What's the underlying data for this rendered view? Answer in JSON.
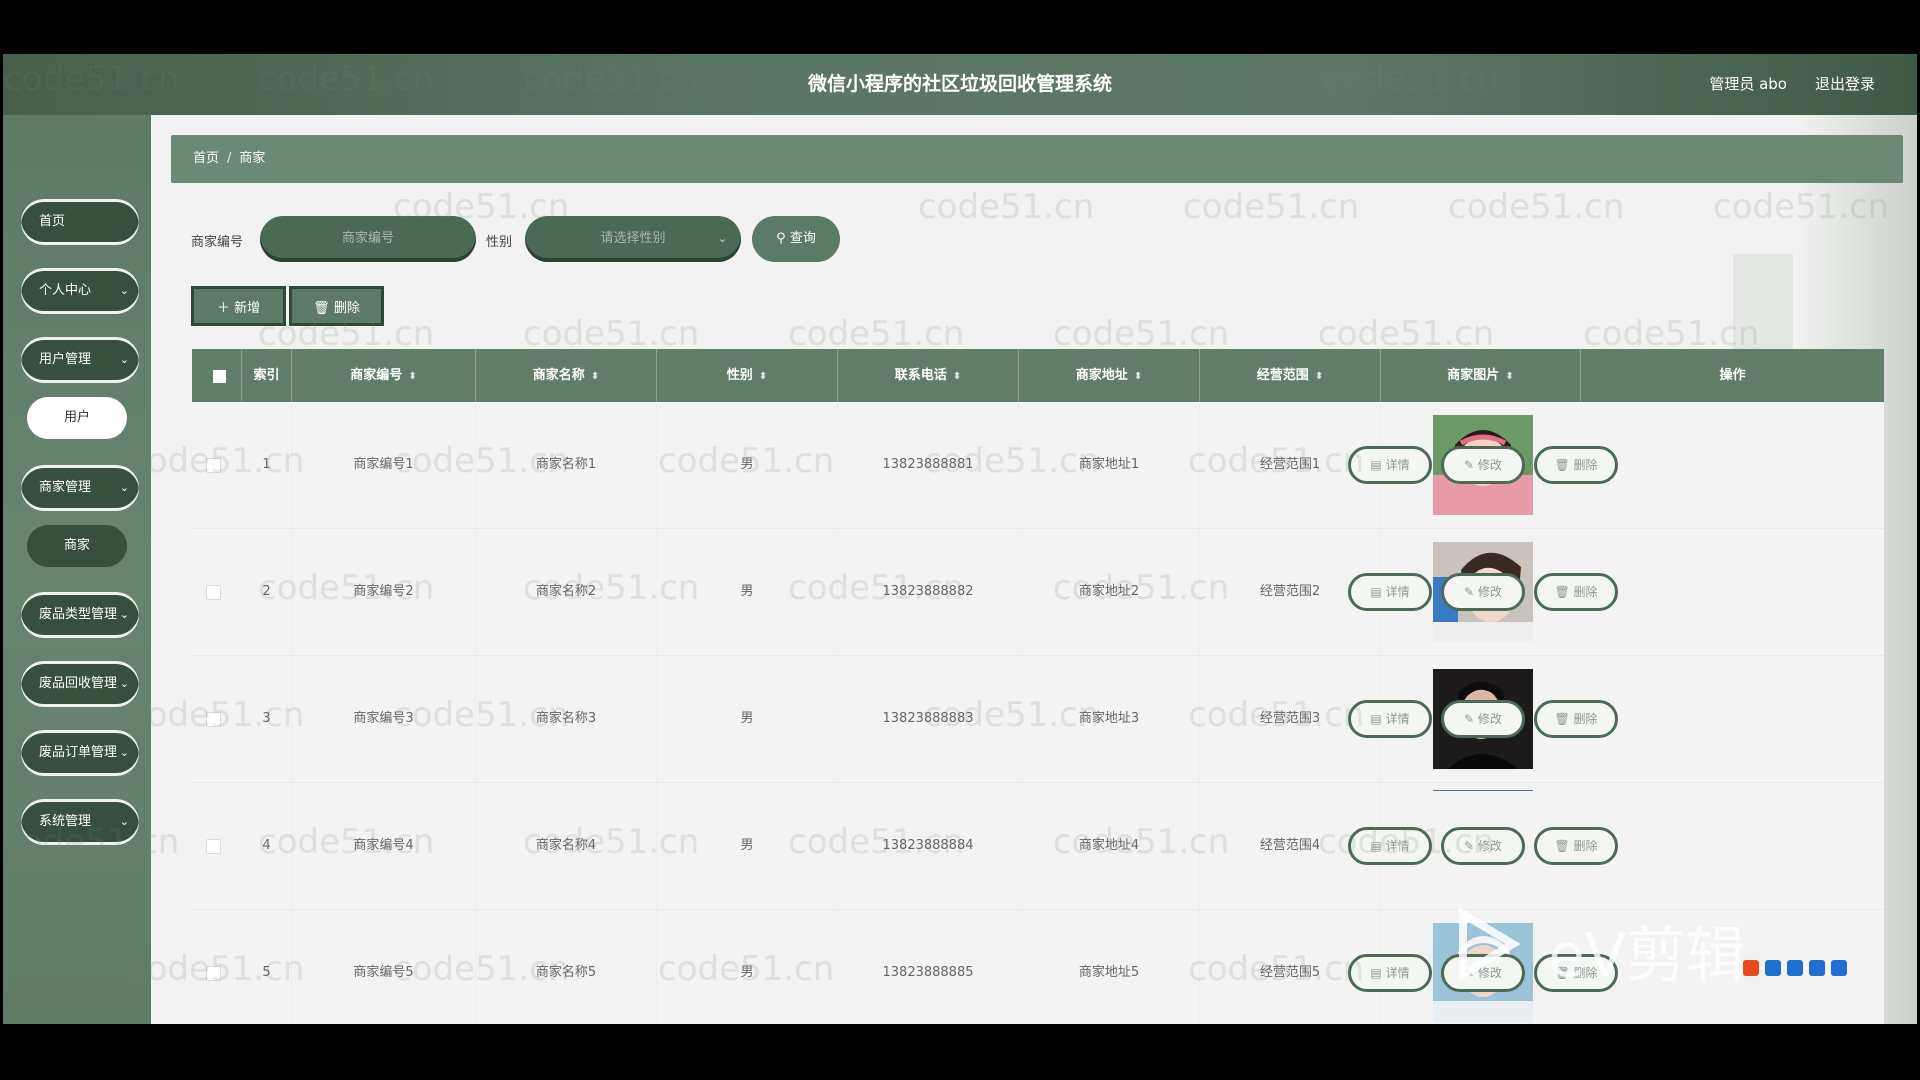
{
  "header": {
    "title": "微信小程序的社区垃圾回收管理系统",
    "user": "管理员 abo",
    "logout": "退出登录"
  },
  "sidebar": {
    "items": [
      {
        "label": "首页",
        "expandable": false
      },
      {
        "label": "个人中心",
        "expandable": true
      },
      {
        "label": "用户管理",
        "expandable": true,
        "children": [
          "用户"
        ]
      },
      {
        "label": "商家管理",
        "expandable": true,
        "children": [
          "商家"
        ]
      },
      {
        "label": "废品类型管理",
        "expandable": true
      },
      {
        "label": "废品回收管理",
        "expandable": true
      },
      {
        "label": "废品订单管理",
        "expandable": true
      },
      {
        "label": "系统管理",
        "expandable": true
      }
    ]
  },
  "breadcrumb": {
    "home": "首页",
    "sep": "/",
    "current": "商家"
  },
  "search": {
    "code_label": "商家编号",
    "code_placeholder": "商家编号",
    "gender_label": "性别",
    "gender_placeholder": "请选择性别",
    "search_button": "查询"
  },
  "toolbar": {
    "add": "新增",
    "delete": "删除"
  },
  "table": {
    "columns": [
      "索引",
      "商家编号",
      "商家名称",
      "性别",
      "联系电话",
      "商家地址",
      "经营范围",
      "商家图片",
      "操作"
    ],
    "rows": [
      {
        "index": "1",
        "code": "商家编号1",
        "name": "商家名称1",
        "gender": "男",
        "phone": "13823888881",
        "address": "商家地址1",
        "scope": "经营范围1"
      },
      {
        "index": "2",
        "code": "商家编号2",
        "name": "商家名称2",
        "gender": "男",
        "phone": "13823888882",
        "address": "商家地址2",
        "scope": "经营范围2"
      },
      {
        "index": "3",
        "code": "商家编号3",
        "name": "商家名称3",
        "gender": "男",
        "phone": "13823888883",
        "address": "商家地址3",
        "scope": "经营范围3"
      },
      {
        "index": "4",
        "code": "商家编号4",
        "name": "商家名称4",
        "gender": "男",
        "phone": "13823888884",
        "address": "商家地址4",
        "scope": "经营范围4"
      },
      {
        "index": "5",
        "code": "商家编号5",
        "name": "商家名称5",
        "gender": "男",
        "phone": "13823888885",
        "address": "商家地址5",
        "scope": "经营范围5"
      }
    ],
    "actions": {
      "detail": "详情",
      "edit": "修改",
      "delete": "删除"
    }
  },
  "watermark": "code51.cn",
  "overlay_logo": "eV剪辑",
  "colors": {
    "primary": "#5f7d69",
    "dark": "#36503e",
    "background": "#f1f2f1"
  }
}
